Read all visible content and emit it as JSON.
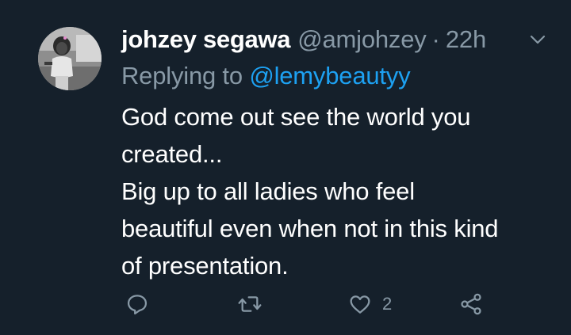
{
  "tweet": {
    "display_name": "johzey segawa",
    "handle": "@amjohzey",
    "separator": "·",
    "time": "22h",
    "replying_prefix": "Replying to ",
    "replying_to": "@lemybeautyy",
    "body_lines": [
      "God come out see the world you",
      "created...",
      "Big up to all ladies who feel",
      "beautiful even when not in this kind",
      "of presentation."
    ],
    "like_count": "2"
  },
  "icons": {
    "menu": "chevron-down-icon",
    "reply": "reply-icon",
    "retweet": "retweet-icon",
    "like": "heart-icon",
    "share": "share-icon"
  },
  "colors": {
    "background": "#15202b",
    "primary_text": "#ffffff",
    "secondary_text": "#8899a6",
    "link": "#1da1f2"
  }
}
